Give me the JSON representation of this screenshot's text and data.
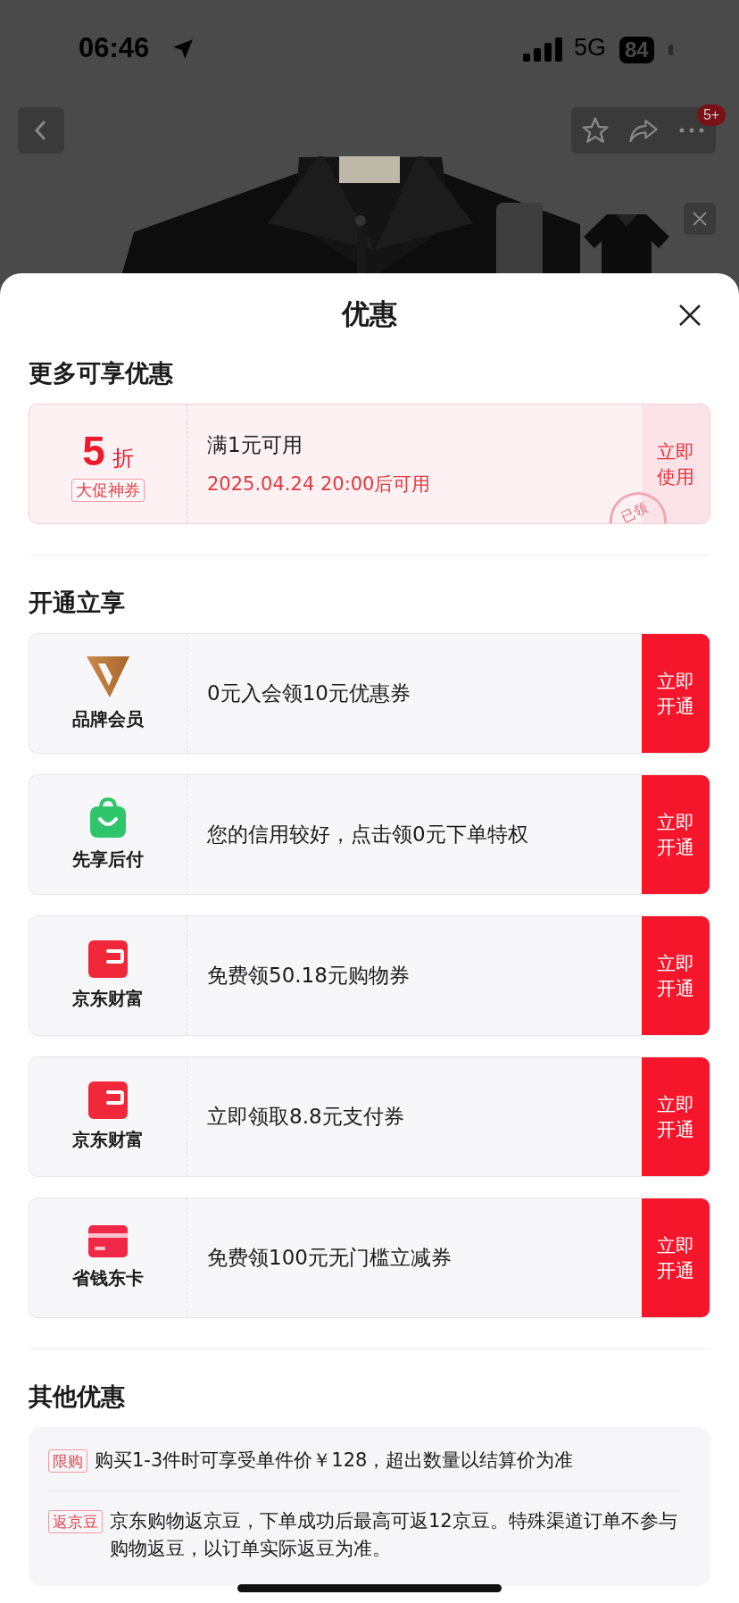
{
  "status_bar": {
    "time": "06:46",
    "network": "5G",
    "battery": "84"
  },
  "nav": {
    "more_badge": "5+"
  },
  "sheet": {
    "title": "优惠"
  },
  "more_offers": {
    "title": "更多可享优惠",
    "coupons": [
      {
        "amount": "5",
        "unit": "折",
        "tag": "大促神券",
        "condition": "满1元可用",
        "validity": "2025.04.24 20:00后可用",
        "action": "立即使用",
        "claimed": true,
        "stamp": "已领"
      }
    ]
  },
  "open_benefits": {
    "title": "开通立享",
    "items": [
      {
        "kind": "brand",
        "name": "品牌会员",
        "description": "0元入会领10元优惠券",
        "action": "立即开通"
      },
      {
        "kind": "bag",
        "name": "先享后付",
        "description": "您的信用较好，点击领0元下单特权",
        "action": "立即开通"
      },
      {
        "kind": "wallet",
        "name": "京东财富",
        "description": "免费领50.18元购物券",
        "action": "立即开通"
      },
      {
        "kind": "wallet",
        "name": "京东财富",
        "description": "立即领取8.8元支付券",
        "action": "立即开通"
      },
      {
        "kind": "card",
        "name": "省钱东卡",
        "description": "免费领100元无门槛立减券",
        "action": "立即开通"
      }
    ]
  },
  "other_offers": {
    "title": "其他优惠",
    "items": [
      {
        "tag": "限购",
        "text": "购买1-3件时可享受单件价￥128，超出数量以结算价为准"
      },
      {
        "tag": "返京豆",
        "text": "京东购物返京豆，下单成功后最高可返12京豆。特殊渠道订单不参与购物返豆，以订单实际返豆为准。"
      }
    ]
  }
}
